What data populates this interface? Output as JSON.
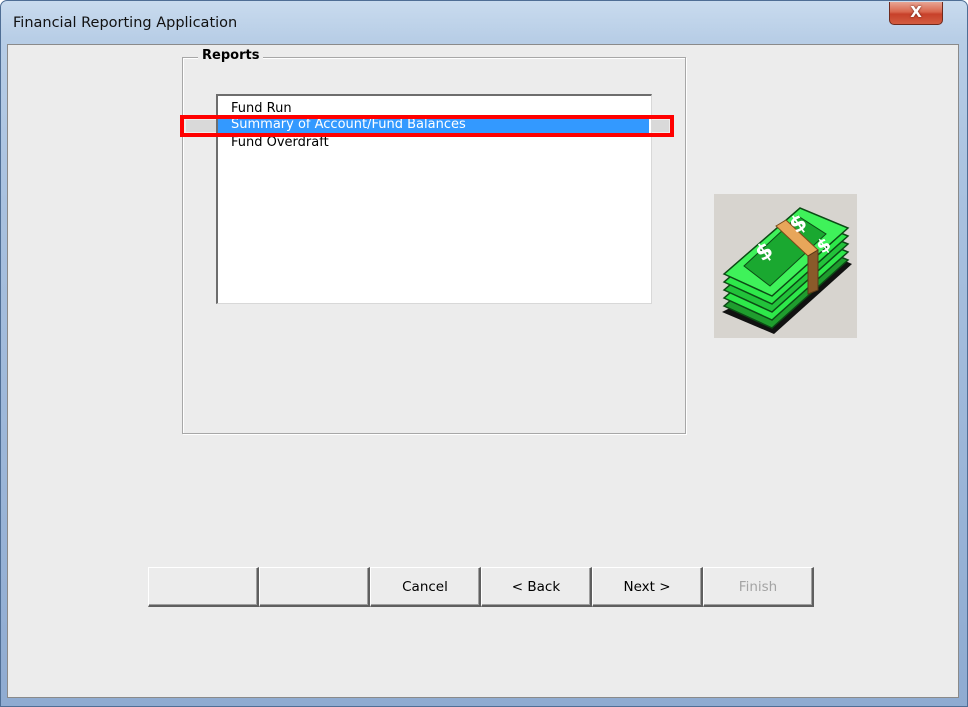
{
  "window": {
    "title": "Financial Reporting Application",
    "close_glyph": "X"
  },
  "reports": {
    "legend": "Reports",
    "items": [
      {
        "label": "Fund Run",
        "selected": false
      },
      {
        "label": "Summary of Account/Fund Balances",
        "selected": true
      },
      {
        "label": "Fund Overdraft",
        "selected": false
      }
    ]
  },
  "illustration": {
    "icon": "money-stack-icon"
  },
  "buttons": {
    "blank1": "",
    "blank2": "",
    "cancel": "Cancel",
    "back": "< Back",
    "next": "Next >",
    "finish": "Finish"
  },
  "colors": {
    "selection": "#3399ff",
    "highlight": "#ff0000",
    "money_green": "#2ee84a",
    "band": "#e8a65a"
  }
}
